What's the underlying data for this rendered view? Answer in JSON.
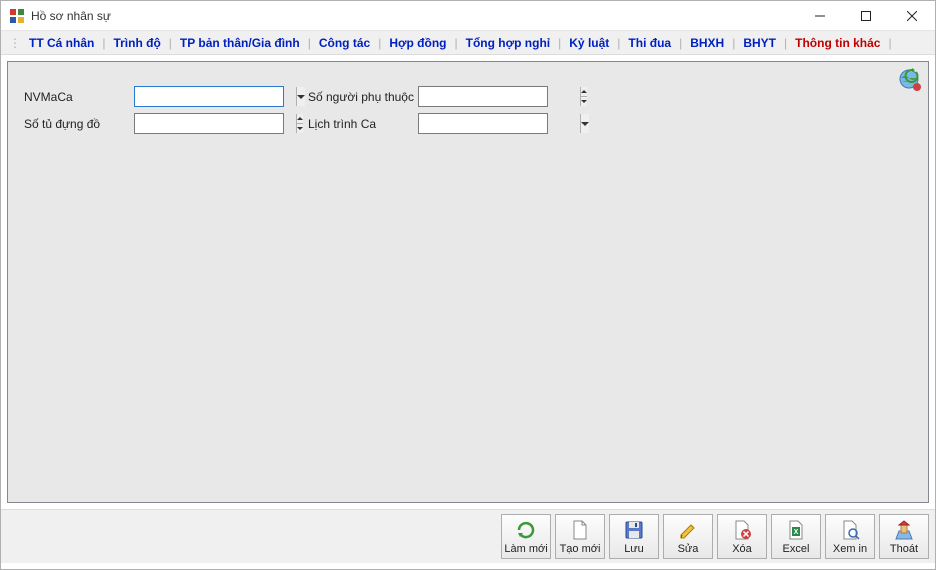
{
  "window": {
    "title": "Hồ sơ nhân sự"
  },
  "tabs": {
    "items": [
      {
        "label": "TT Cá nhân",
        "active": false
      },
      {
        "label": "Trình độ",
        "active": false
      },
      {
        "label": "TP bản thân/Gia đình",
        "active": false
      },
      {
        "label": "Công tác",
        "active": false
      },
      {
        "label": "Hợp đồng",
        "active": false
      },
      {
        "label": "Tổng hợp nghỉ",
        "active": false
      },
      {
        "label": "Kỷ luật",
        "active": false
      },
      {
        "label": "Thi đua",
        "active": false
      },
      {
        "label": "BHXH",
        "active": false
      },
      {
        "label": "BHYT",
        "active": false
      },
      {
        "label": "Thông tin khác",
        "active": true
      }
    ]
  },
  "form": {
    "nvmaca": {
      "label": "NVMaCa",
      "value": ""
    },
    "so_tu_dung_do": {
      "label": "Số tủ đựng đồ",
      "value": ""
    },
    "so_nguoi_phu_thuoc": {
      "label": "Số người phụ thuộc",
      "value": ""
    },
    "lich_trinh_ca": {
      "label": "Lịch trình Ca",
      "value": ""
    }
  },
  "toolbar": {
    "lam_moi": "Làm mới",
    "tao_moi": "Tạo mới",
    "luu": "Lưu",
    "sua": "Sửa",
    "xoa": "Xóa",
    "excel": "Excel",
    "xem_in": "Xem in",
    "thoat": "Thoát"
  }
}
